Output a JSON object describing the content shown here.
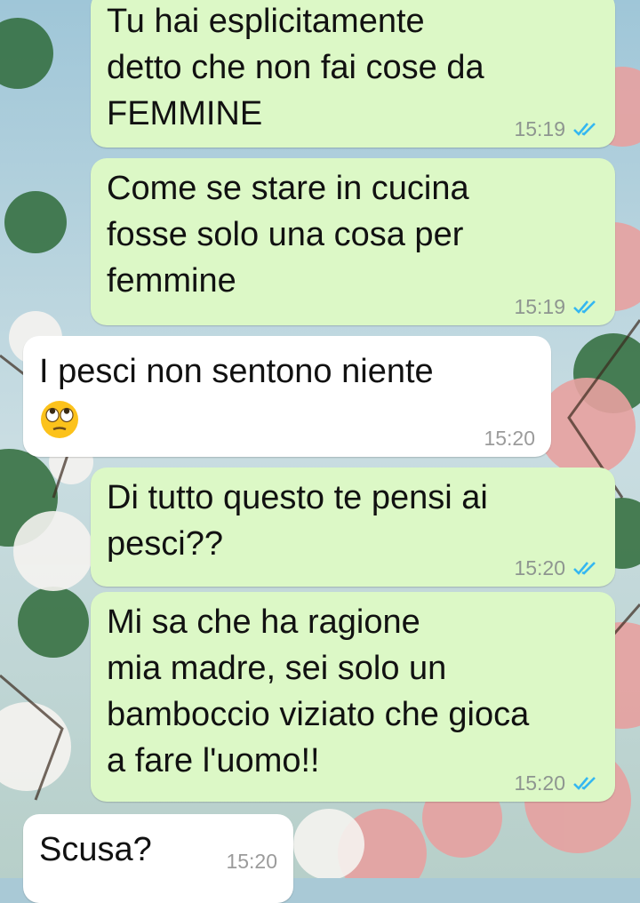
{
  "colors": {
    "outgoing_bubble": "#dcf8c6",
    "incoming_bubble": "#ffffff",
    "read_ticks": "#34b7f1",
    "timestamp": "#8e9590"
  },
  "messages": [
    {
      "direction": "outgoing",
      "text": "Tu hai esplicitamente\ndetto che non fai cose da\nFEMMINE",
      "time": "15:19",
      "status": "read"
    },
    {
      "direction": "outgoing",
      "text": "Come se stare in cucina\nfosse solo una cosa per\nfemmine",
      "time": "15:19",
      "status": "read"
    },
    {
      "direction": "incoming",
      "text": "I pesci non sentono niente",
      "emoji": "face-with-rolling-eyes",
      "time": "15:20"
    },
    {
      "direction": "outgoing",
      "text": "Di tutto questo te pensi ai\npesci??",
      "time": "15:20",
      "status": "read"
    },
    {
      "direction": "outgoing",
      "text": "Mi sa che ha ragione\nmia madre, sei solo un\nbamboccio viziato che gioca\na fare l'uomo!!",
      "time": "15:20",
      "status": "read"
    },
    {
      "direction": "incoming",
      "text": "Scusa?",
      "time": "15:20"
    }
  ]
}
